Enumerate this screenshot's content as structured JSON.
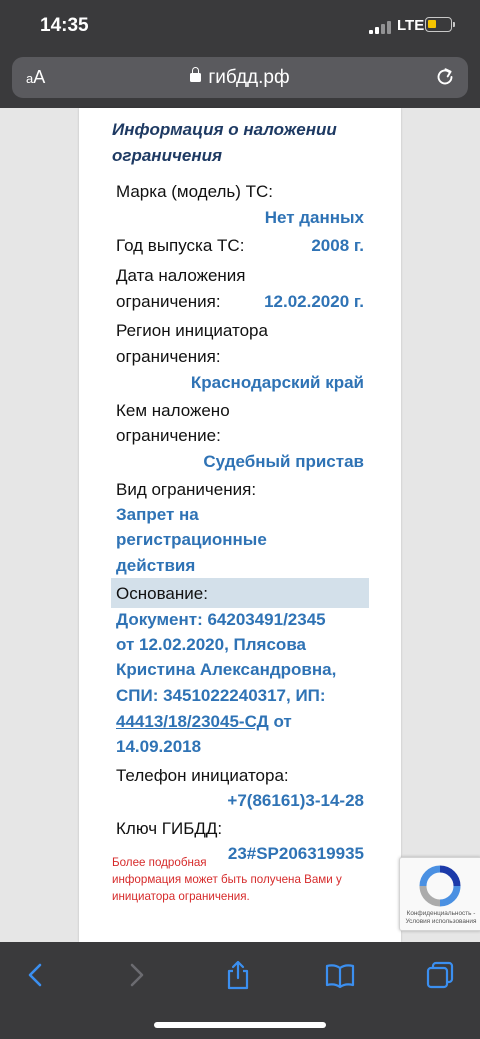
{
  "status_bar": {
    "time": "14:35",
    "network": "LTE"
  },
  "address_bar": {
    "text_size": "AA",
    "domain": "гибдд.рф"
  },
  "section": {
    "title": "Информация о наложении ограничения"
  },
  "fields": {
    "brand_label": "Марка (модель) ТС:",
    "brand_value": "Нет данных",
    "year_label": "Год выпуска ТС:",
    "year_value": "2008 г.",
    "date_label_1": "Дата наложения",
    "date_label_2": "ограничения:",
    "date_value": "12.02.2020 г.",
    "region_label_1": "Регион инициатора",
    "region_label_2": "ограничения:",
    "region_value": "Краснодарский край",
    "who_label_1": "Кем наложено",
    "who_label_2": "ограничение:",
    "who_value": "Судебный пристав",
    "type_label": "Вид ограничения:",
    "type_value_1": "Запрет на",
    "type_value_2": "регистрационные",
    "type_value_3": "действия",
    "basis_label": "Основание:",
    "basis_line_1": "Документ: 64203491/2345",
    "basis_line_2": "от 12.02.2020, Плясова",
    "basis_line_3": "Кристина Александровна,",
    "basis_line_4": "СПИ: 3451022240317, ИП:",
    "basis_ip_link": "44413/18/23045-СД",
    "basis_line_5_tail": " от",
    "basis_line_6": "14.09.2018",
    "phone_label": "Телефон инициатора:",
    "phone_value": "+7(86161)3-14-28",
    "key_label": "Ключ ГИБДД:",
    "key_value": "23#SP206319935"
  },
  "note": {
    "line_1": "Более подробная",
    "line_2": "информация может быть получена Вами у",
    "line_3": "инициатора ограничения."
  },
  "recaptcha": {
    "line_1": "Конфиденциальность -",
    "line_2": "Условия использования"
  },
  "colors": {
    "heading": "#1e3a63",
    "value": "#2f73b5",
    "note": "#d62b2b",
    "highlight": "#d3e0ea",
    "chrome": "#3a3a3c",
    "toolbar_icon": "#3b8ff0"
  },
  "toolbar": {
    "icons": [
      "back-icon",
      "forward-icon",
      "share-icon",
      "bookmarks-icon",
      "tabs-icon"
    ]
  }
}
